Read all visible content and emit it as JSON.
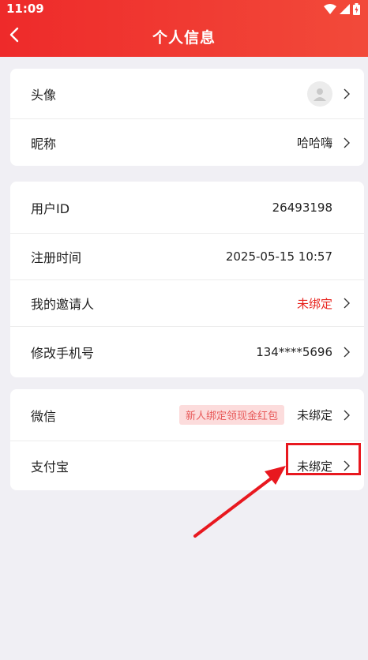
{
  "status_bar": {
    "time": "11:09"
  },
  "header": {
    "title": "个人信息"
  },
  "section1": [
    {
      "label": "头像"
    },
    {
      "label": "昵称",
      "value": "哈哈嗨"
    }
  ],
  "section2": [
    {
      "label": "用户ID",
      "value": "26493198"
    },
    {
      "label": "注册时间",
      "value": "2025-05-15 10:57"
    },
    {
      "label": "我的邀请人",
      "value": "未绑定"
    },
    {
      "label": "修改手机号",
      "value": "134****5696"
    }
  ],
  "section3": [
    {
      "label": "微信",
      "promo": "新人绑定领现金红包",
      "value": "未绑定"
    },
    {
      "label": "支付宝",
      "value": "未绑定"
    }
  ],
  "colors": {
    "accent": "#ee2a2a",
    "annotation": "#e8181f"
  },
  "icons": [
    "back-icon",
    "wifi-icon",
    "signal-icon",
    "battery-icon",
    "avatar-placeholder-icon",
    "chevron-right-icon"
  ]
}
